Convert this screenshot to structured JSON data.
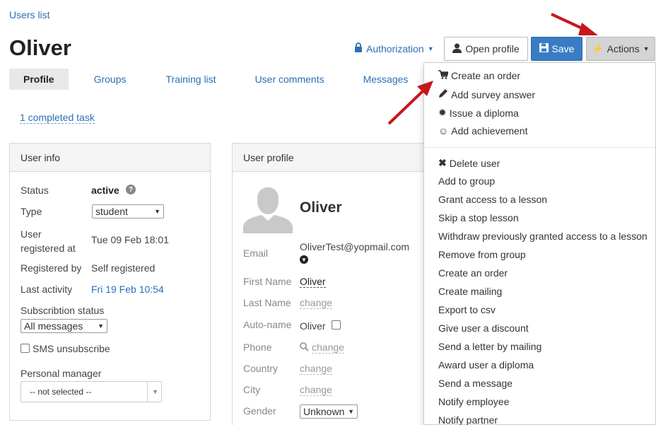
{
  "breadcrumb": "Users list",
  "page_title": "Oliver",
  "header": {
    "authorization_label": "Authorization",
    "open_profile_label": "Open profile",
    "save_label": "Save",
    "actions_label": "Actions"
  },
  "tabs": [
    "Profile",
    "Groups",
    "Training list",
    "User comments",
    "Messages"
  ],
  "completed_task": "1 completed task",
  "user_info": {
    "title": "User info",
    "status_label": "Status",
    "status_value": "active",
    "type_label": "Type",
    "type_value": "student",
    "registered_label": "User registered at",
    "registered_label_1": "User",
    "registered_label_2": "registered at",
    "registered_value": "Tue 09 Feb 18:01",
    "registered_by_label": "Registered by",
    "registered_by_value": "Self registered",
    "last_activity_label": "Last activity",
    "last_activity_value": "Fri 19 Feb 10:54",
    "subscription_label": "Subscribtion status",
    "subscription_value": "All messages",
    "sms_label": "SMS unsubscribe",
    "manager_label": "Personal manager",
    "manager_value": "-- not selected --"
  },
  "user_profile": {
    "title": "User profile",
    "name": "Oliver",
    "email_label": "Email",
    "email_value": "OliverTest@yopmail.com",
    "first_name_label": "First Name",
    "first_name_value": "Oliver",
    "last_name_label": "Last Name",
    "last_name_value": "change",
    "autoname_label": "Auto-name",
    "autoname_value": "Oliver",
    "phone_label": "Phone",
    "phone_value": "change",
    "country_label": "Country",
    "country_value": "change",
    "city_label": "City",
    "city_value": "change",
    "gender_label": "Gender",
    "gender_value": "Unknown"
  },
  "actions_menu": {
    "group1": [
      {
        "label": "Create an order",
        "icon": "cart-icon"
      },
      {
        "label": "Add survey answer",
        "icon": "pencil-icon"
      },
      {
        "label": "Issue a diploma",
        "icon": "certificate-icon"
      },
      {
        "label": "Add achievement",
        "icon": "smile-icon"
      }
    ],
    "group2": [
      {
        "label": "Delete user",
        "icon": "close-icon"
      },
      {
        "label": "Add to group"
      },
      {
        "label": "Grant access to a lesson"
      },
      {
        "label": "Skip a stop lesson"
      },
      {
        "label": "Withdraw previously granted access to a lesson"
      },
      {
        "label": "Remove from group"
      },
      {
        "label": "Create an order"
      },
      {
        "label": "Create mailing"
      },
      {
        "label": "Export to csv"
      },
      {
        "label": "Give user a discount"
      },
      {
        "label": "Send a letter by mailing"
      },
      {
        "label": "Award user a diploma"
      },
      {
        "label": "Send a message"
      },
      {
        "label": "Notify employee"
      },
      {
        "label": "Notify partner"
      }
    ]
  },
  "colors": {
    "link": "#2b6fb6",
    "save_button": "#3a7cc4",
    "arrow": "#c8161d"
  }
}
